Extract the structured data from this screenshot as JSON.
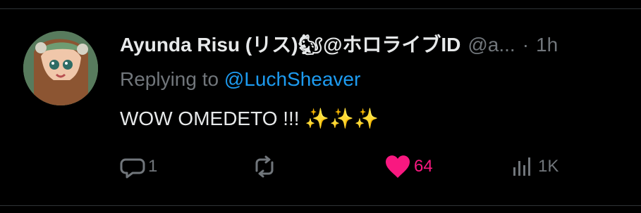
{
  "tweet": {
    "author_name": "Ayunda Risu (リス)🐿@ホロライブID",
    "handle": "@a...",
    "separator": "·",
    "time": "1h",
    "replying_prefix": "Replying to ",
    "replying_to": "@LuchSheaver",
    "text": "WOW OMEDETO !!! ",
    "sparkles": "✨✨✨"
  },
  "actions": {
    "replies": "1",
    "reposts": "",
    "likes": "64",
    "views": "1K"
  },
  "colors": {
    "background": "#000000",
    "text": "#e7e9ea",
    "muted": "#71767b",
    "link": "#1d9bf0",
    "like": "#f91880"
  },
  "icons": {
    "reply": "speech-bubble-icon",
    "repost": "repost-arrows-icon",
    "like": "heart-filled-icon",
    "views": "bar-chart-icon"
  }
}
